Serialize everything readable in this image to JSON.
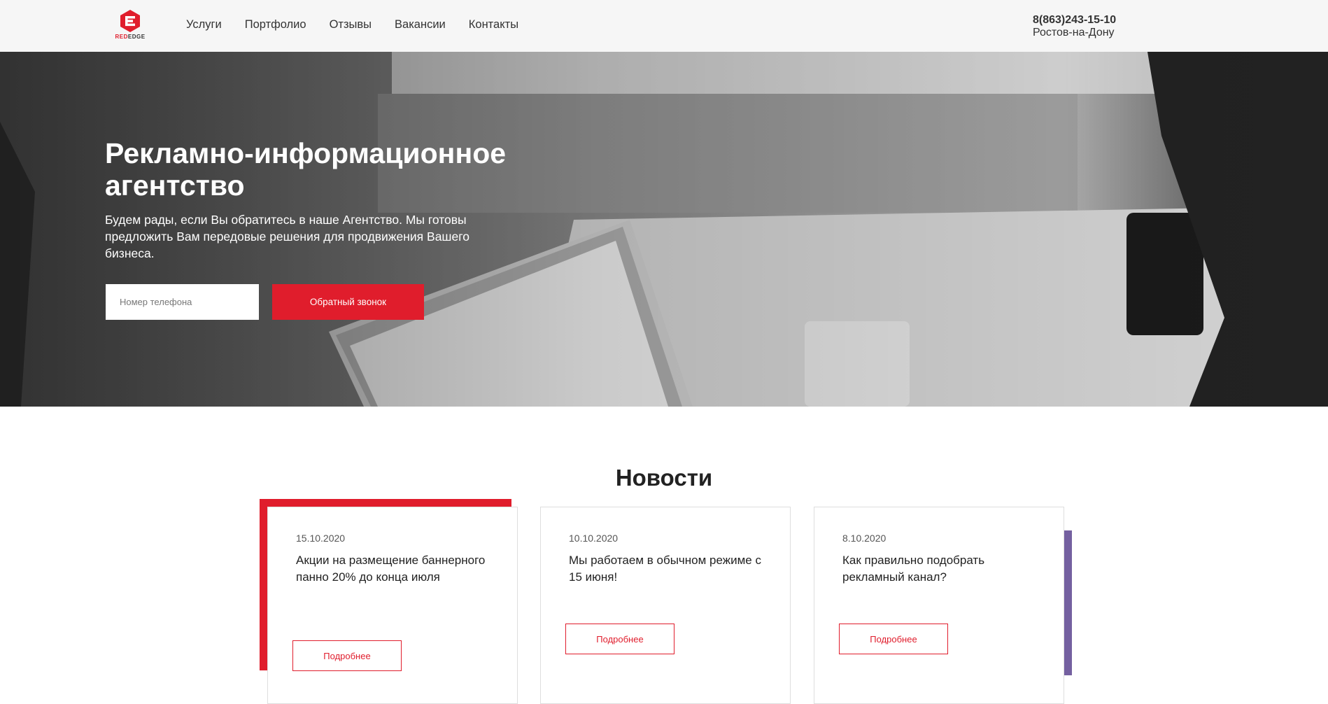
{
  "logo": {
    "text_red": "RED",
    "text_dark": "EDGE"
  },
  "nav": [
    "Услуги",
    "Портфолио",
    "Отзывы",
    "Вакансии",
    "Контакты"
  ],
  "contact": {
    "phone": "8(863)243-15-10",
    "city": "Ростов-на-Дону"
  },
  "hero": {
    "title": "Рекламно-информационное агентство",
    "text": "Будем рады, если Вы обратитесь в наше Агентство. Мы готовы предложить Вам передовые решения для продвижения Вашего бизнеса.",
    "phone_placeholder": "Номер телефона",
    "callback_label": "Обратный звонок"
  },
  "news": {
    "title": "Новости",
    "items": [
      {
        "date": "15.10.2020",
        "title": "Акции на размещение баннерного панно 20% до конца июля",
        "button": "Подробнее"
      },
      {
        "date": "10.10.2020",
        "title": "Мы работаем в обычном режиме с 15 июня!",
        "button": "Подробнее"
      },
      {
        "date": "8.10.2020",
        "title": "Как правильно подобрать рекламный канал?",
        "button": "Подробнее"
      }
    ]
  },
  "colors": {
    "accent": "#e01d2c",
    "purple": "#7460a0",
    "header_bg": "#f6f6f6"
  }
}
